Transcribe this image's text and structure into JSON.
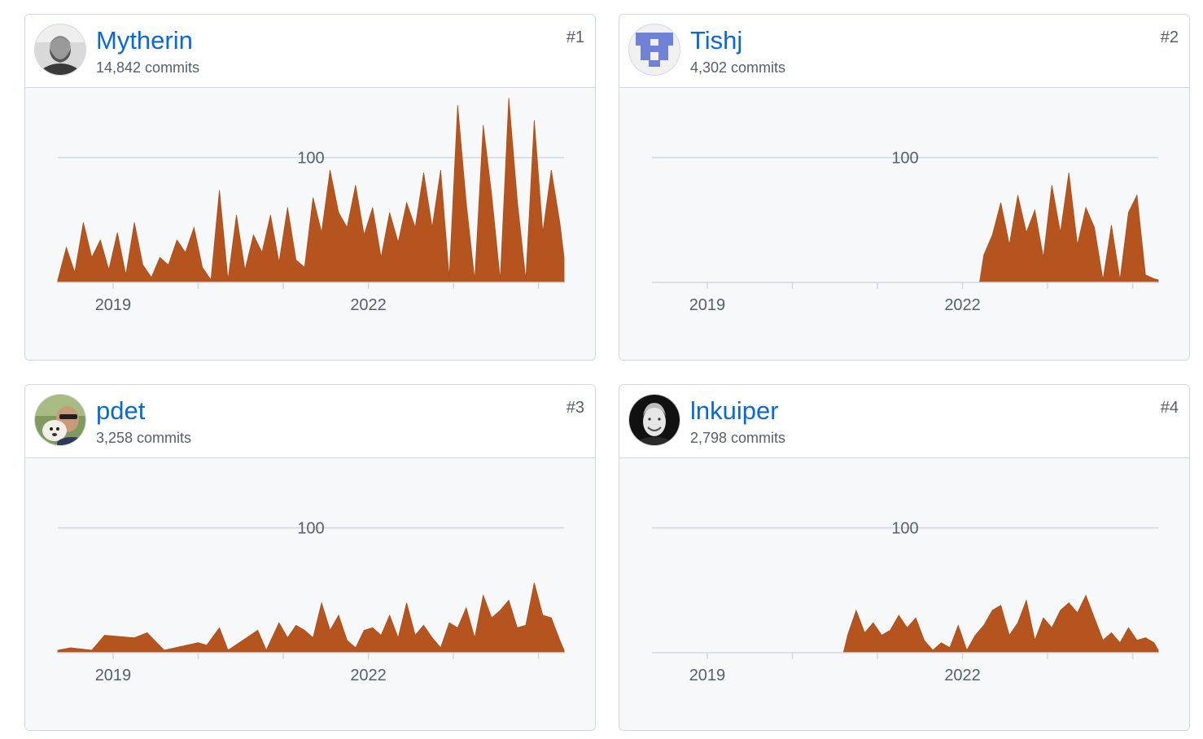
{
  "contributors": [
    {
      "rank": "#1",
      "name": "Mytherin",
      "commits": "14,842 commits",
      "avatar": "person-photo-beard-icon",
      "chart_data": {
        "type": "area",
        "xlim": [
          2018.35,
          2024.3
        ],
        "ylim": [
          0,
          150
        ],
        "y_ticks": [
          100
        ],
        "y_tick_labels": [
          "100"
        ],
        "x_ticks": [
          2019,
          2020,
          2021,
          2022,
          2023,
          2024
        ],
        "x_tick_labels": [
          "2019",
          "",
          "",
          "2022",
          "",
          ""
        ],
        "x": [
          2018.35,
          2018.45,
          2018.55,
          2018.65,
          2018.75,
          2018.85,
          2018.95,
          2019.05,
          2019.15,
          2019.25,
          2019.35,
          2019.45,
          2019.55,
          2019.65,
          2019.75,
          2019.85,
          2019.95,
          2020.05,
          2020.15,
          2020.25,
          2020.35,
          2020.45,
          2020.55,
          2020.65,
          2020.75,
          2020.85,
          2020.95,
          2021.05,
          2021.15,
          2021.25,
          2021.35,
          2021.45,
          2021.55,
          2021.65,
          2021.75,
          2021.85,
          2021.95,
          2022.05,
          2022.15,
          2022.25,
          2022.35,
          2022.45,
          2022.55,
          2022.65,
          2022.75,
          2022.85,
          2022.95,
          2023.05,
          2023.15,
          2023.25,
          2023.35,
          2023.45,
          2023.55,
          2023.65,
          2023.75,
          2023.85,
          2023.95,
          2024.05,
          2024.15,
          2024.25,
          2024.3
        ],
        "values": [
          2,
          28,
          8,
          48,
          20,
          34,
          10,
          40,
          6,
          48,
          14,
          4,
          20,
          14,
          34,
          24,
          44,
          12,
          2,
          74,
          2,
          54,
          10,
          38,
          24,
          54,
          16,
          60,
          18,
          12,
          68,
          40,
          90,
          56,
          44,
          78,
          38,
          60,
          20,
          56,
          32,
          64,
          44,
          88,
          44,
          90,
          4,
          142,
          64,
          2,
          126,
          70,
          2,
          148,
          66,
          2,
          130,
          40,
          90,
          48,
          20
        ]
      }
    },
    {
      "rank": "#2",
      "name": "Tishj",
      "commits": "4,302 commits",
      "avatar": "identicon-blue-icon",
      "chart_data": {
        "type": "area",
        "xlim": [
          2018.35,
          2024.3
        ],
        "ylim": [
          0,
          150
        ],
        "y_ticks": [
          100
        ],
        "y_tick_labels": [
          "100"
        ],
        "x_ticks": [
          2019,
          2020,
          2021,
          2022,
          2023,
          2024
        ],
        "x_tick_labels": [
          "2019",
          "",
          "",
          "2022",
          "",
          ""
        ],
        "x": [
          2018.35,
          2022.2,
          2022.25,
          2022.35,
          2022.45,
          2022.55,
          2022.65,
          2022.75,
          2022.85,
          2022.95,
          2023.05,
          2023.15,
          2023.25,
          2023.35,
          2023.45,
          2023.55,
          2023.65,
          2023.75,
          2023.85,
          2023.95,
          2024.05,
          2024.15,
          2024.25,
          2024.3
        ],
        "values": [
          0,
          0,
          22,
          38,
          64,
          30,
          70,
          40,
          58,
          20,
          78,
          40,
          88,
          30,
          60,
          44,
          2,
          46,
          2,
          56,
          70,
          6,
          3,
          2
        ]
      }
    },
    {
      "rank": "#3",
      "name": "pdet",
      "commits": "3,258 commits",
      "avatar": "person-photo-dog-icon",
      "chart_data": {
        "type": "area",
        "xlim": [
          2018.35,
          2024.3
        ],
        "ylim": [
          0,
          150
        ],
        "y_ticks": [
          100
        ],
        "y_tick_labels": [
          "100"
        ],
        "x_ticks": [
          2019,
          2020,
          2021,
          2022,
          2023,
          2024
        ],
        "x_tick_labels": [
          "2019",
          "",
          "",
          "2022",
          "",
          ""
        ],
        "x": [
          2018.35,
          2018.5,
          2018.75,
          2018.9,
          2019.25,
          2019.4,
          2019.6,
          2020.0,
          2020.1,
          2020.25,
          2020.35,
          2020.7,
          2020.8,
          2020.95,
          2021.05,
          2021.15,
          2021.25,
          2021.35,
          2021.45,
          2021.55,
          2021.65,
          2021.75,
          2021.85,
          2021.95,
          2022.05,
          2022.15,
          2022.25,
          2022.35,
          2022.45,
          2022.55,
          2022.65,
          2022.75,
          2022.85,
          2022.95,
          2023.05,
          2023.15,
          2023.25,
          2023.35,
          2023.45,
          2023.55,
          2023.65,
          2023.75,
          2023.85,
          2023.95,
          2024.05,
          2024.15,
          2024.25,
          2024.3
        ],
        "values": [
          2,
          4,
          2,
          14,
          12,
          16,
          2,
          8,
          6,
          20,
          2,
          18,
          2,
          24,
          12,
          22,
          18,
          12,
          40,
          18,
          30,
          10,
          4,
          18,
          20,
          14,
          30,
          12,
          40,
          14,
          22,
          12,
          4,
          24,
          20,
          36,
          12,
          46,
          28,
          34,
          42,
          20,
          22,
          56,
          30,
          28,
          10,
          2
        ]
      }
    },
    {
      "rank": "#4",
      "name": "lnkuiper",
      "commits": "2,798 commits",
      "avatar": "person-photo-bw-icon",
      "chart_data": {
        "type": "area",
        "xlim": [
          2018.35,
          2024.3
        ],
        "ylim": [
          0,
          150
        ],
        "y_ticks": [
          100
        ],
        "y_tick_labels": [
          "100"
        ],
        "x_ticks": [
          2019,
          2020,
          2021,
          2022,
          2023,
          2024
        ],
        "x_tick_labels": [
          "2019",
          "",
          "",
          "2022",
          "",
          ""
        ],
        "x": [
          2018.35,
          2020.6,
          2020.65,
          2020.75,
          2020.85,
          2020.95,
          2021.05,
          2021.15,
          2021.25,
          2021.35,
          2021.45,
          2021.55,
          2021.65,
          2021.75,
          2021.85,
          2021.95,
          2022.05,
          2022.15,
          2022.25,
          2022.35,
          2022.45,
          2022.55,
          2022.65,
          2022.75,
          2022.85,
          2022.95,
          2023.05,
          2023.15,
          2023.25,
          2023.35,
          2023.45,
          2023.55,
          2023.65,
          2023.75,
          2023.85,
          2023.95,
          2024.05,
          2024.15,
          2024.25,
          2024.3
        ],
        "values": [
          0,
          0,
          14,
          34,
          16,
          24,
          14,
          18,
          30,
          20,
          28,
          10,
          2,
          8,
          4,
          22,
          2,
          14,
          22,
          34,
          38,
          14,
          24,
          42,
          10,
          28,
          20,
          34,
          40,
          32,
          46,
          28,
          10,
          16,
          8,
          20,
          10,
          12,
          8,
          2
        ]
      }
    }
  ],
  "colors": {
    "area_fill": "#b5541e",
    "area_stroke": "#a9501c",
    "gridline": "#d0d7de",
    "link": "#0969da",
    "muted_text": "#57606a",
    "chart_bg": "#f6f8fa"
  }
}
